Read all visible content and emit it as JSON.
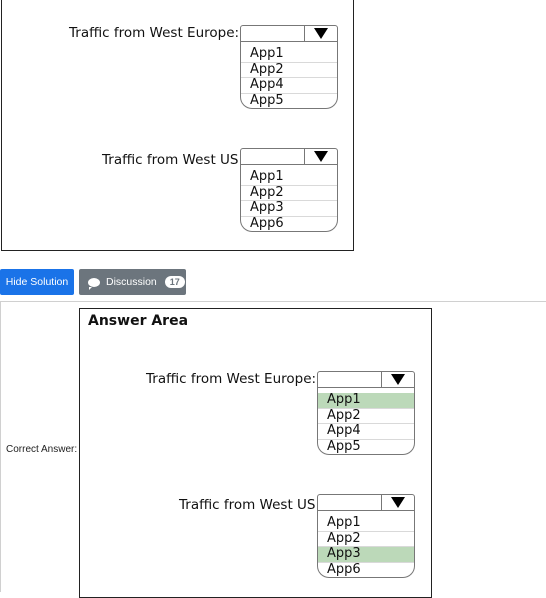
{
  "question": {
    "west_europe": {
      "label": "Traffic from West Europe:",
      "options": [
        "App1",
        "App2",
        "App4",
        "App5"
      ]
    },
    "west_us": {
      "label": "Traffic from West US:",
      "options": [
        "App1",
        "App2",
        "App3",
        "App6"
      ]
    }
  },
  "buttons": {
    "hide_solution": "Hide Solution",
    "discussion": "Discussion",
    "discussion_count": "17"
  },
  "answer": {
    "correct_answer_label": "Correct Answer:",
    "area_title": "Answer Area",
    "west_europe": {
      "label": "Traffic from West Europe:",
      "options": [
        "App1",
        "App2",
        "App4",
        "App5"
      ],
      "selected": "App1"
    },
    "west_us": {
      "label": "Traffic from West US:",
      "options": [
        "App1",
        "App2",
        "App3",
        "App6"
      ],
      "selected": "App3"
    }
  },
  "colors": {
    "hide_button": "#1a73e8",
    "discussion_button": "#6c757d",
    "selected_option": "#bcd9b9"
  }
}
